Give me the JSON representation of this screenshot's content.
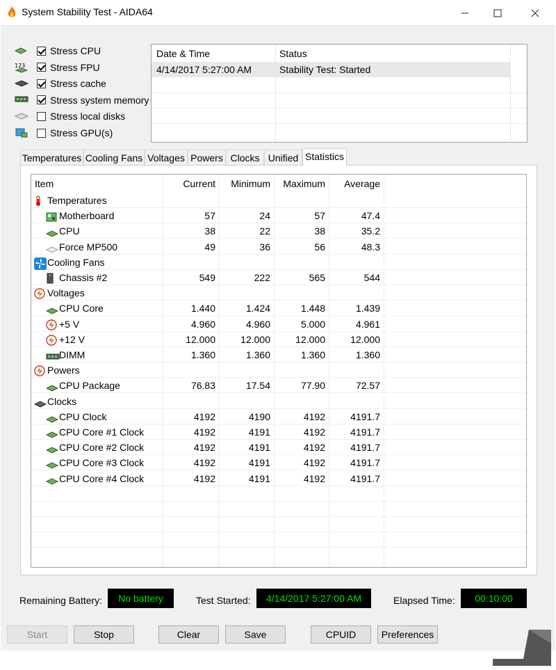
{
  "window": {
    "title": "System Stability Test - AIDA64"
  },
  "options": [
    {
      "label": "Stress CPU",
      "checked": true,
      "icon": "cpu-icon"
    },
    {
      "label": "Stress FPU",
      "checked": true,
      "icon": "fpu-icon"
    },
    {
      "label": "Stress cache",
      "checked": true,
      "icon": "cache-icon"
    },
    {
      "label": "Stress system memory",
      "checked": true,
      "icon": "memory-icon"
    },
    {
      "label": "Stress local disks",
      "checked": false,
      "icon": "disk-icon"
    },
    {
      "label": "Stress GPU(s)",
      "checked": false,
      "icon": "gpu-icon"
    }
  ],
  "log": {
    "headers": {
      "datetime": "Date & Time",
      "status": "Status"
    },
    "rows": [
      {
        "datetime": "4/14/2017 5:27:00 AM",
        "status": "Stability Test: Started"
      }
    ]
  },
  "tabs": [
    "Temperatures",
    "Cooling Fans",
    "Voltages",
    "Powers",
    "Clocks",
    "Unified",
    "Statistics"
  ],
  "active_tab": "Statistics",
  "stats": {
    "headers": {
      "item": "Item",
      "current": "Current",
      "minimum": "Minimum",
      "maximum": "Maximum",
      "average": "Average"
    },
    "rows": [
      {
        "type": "group",
        "label": "Temperatures",
        "icon": "thermometer-icon"
      },
      {
        "type": "item",
        "label": "Motherboard",
        "icon": "motherboard-icon",
        "current": "57",
        "minimum": "24",
        "maximum": "57",
        "average": "47.4"
      },
      {
        "type": "item",
        "label": "CPU",
        "icon": "cpu-icon",
        "current": "38",
        "minimum": "22",
        "maximum": "38",
        "average": "35.2"
      },
      {
        "type": "item",
        "label": "Force MP500",
        "icon": "drive-icon",
        "current": "49",
        "minimum": "36",
        "maximum": "56",
        "average": "48.3"
      },
      {
        "type": "group",
        "label": "Cooling Fans",
        "icon": "fan-icon"
      },
      {
        "type": "item",
        "label": "Chassis #2",
        "icon": "chassis-icon",
        "current": "549",
        "minimum": "222",
        "maximum": "565",
        "average": "544"
      },
      {
        "type": "group",
        "label": "Voltages",
        "icon": "lightning-icon"
      },
      {
        "type": "item",
        "label": "CPU Core",
        "icon": "cpu-icon",
        "current": "1.440",
        "minimum": "1.424",
        "maximum": "1.448",
        "average": "1.439"
      },
      {
        "type": "item",
        "label": "+5 V",
        "icon": "lightning-icon",
        "current": "4.960",
        "minimum": "4.960",
        "maximum": "5.000",
        "average": "4.961"
      },
      {
        "type": "item",
        "label": "+12 V",
        "icon": "lightning-icon",
        "current": "12.000",
        "minimum": "12.000",
        "maximum": "12.000",
        "average": "12.000"
      },
      {
        "type": "item",
        "label": "DIMM",
        "icon": "memory-icon",
        "current": "1.360",
        "minimum": "1.360",
        "maximum": "1.360",
        "average": "1.360"
      },
      {
        "type": "group",
        "label": "Powers",
        "icon": "lightning-icon"
      },
      {
        "type": "item",
        "label": "CPU Package",
        "icon": "cpu-icon",
        "current": "76.83",
        "minimum": "17.54",
        "maximum": "77.90",
        "average": "72.57"
      },
      {
        "type": "group",
        "label": "Clocks",
        "icon": "clock-chip-icon"
      },
      {
        "type": "item",
        "label": "CPU Clock",
        "icon": "cpu-icon",
        "current": "4192",
        "minimum": "4190",
        "maximum": "4192",
        "average": "4191.7"
      },
      {
        "type": "item",
        "label": "CPU Core #1 Clock",
        "icon": "cpu-icon",
        "current": "4192",
        "minimum": "4191",
        "maximum": "4192",
        "average": "4191.7"
      },
      {
        "type": "item",
        "label": "CPU Core #2 Clock",
        "icon": "cpu-icon",
        "current": "4192",
        "minimum": "4191",
        "maximum": "4192",
        "average": "4191.7"
      },
      {
        "type": "item",
        "label": "CPU Core #3 Clock",
        "icon": "cpu-icon",
        "current": "4192",
        "minimum": "4191",
        "maximum": "4192",
        "average": "4191.7"
      },
      {
        "type": "item",
        "label": "CPU Core #4 Clock",
        "icon": "cpu-icon",
        "current": "4192",
        "minimum": "4191",
        "maximum": "4192",
        "average": "4191.7"
      }
    ]
  },
  "status": {
    "battery_label": "Remaining Battery:",
    "battery_value": "No battery",
    "started_label": "Test Started:",
    "started_value": "4/14/2017 5:27:00 AM",
    "elapsed_label": "Elapsed Time:",
    "elapsed_value": "00:10:00"
  },
  "buttons": {
    "start": "Start",
    "stop": "Stop",
    "clear": "Clear",
    "save": "Save",
    "cpuid": "CPUID",
    "preferences": "Preferences"
  },
  "colors": {
    "status_text": "#00e000",
    "status_bg": "#000000",
    "panel_bg": "#f0f0f0"
  }
}
